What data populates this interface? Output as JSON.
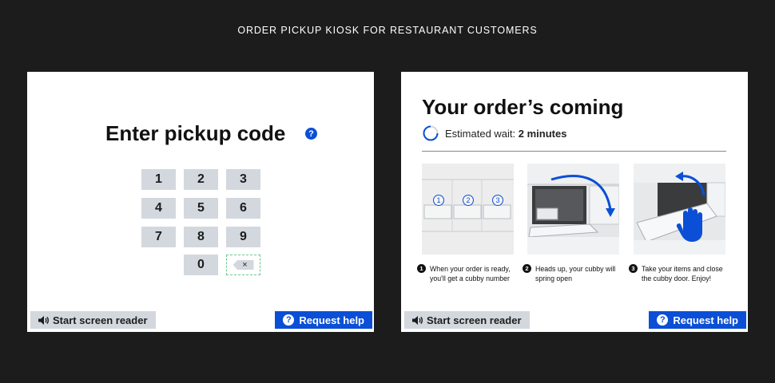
{
  "page": {
    "title": "ORDER PICKUP KIOSK FOR RESTAURANT CUSTOMERS"
  },
  "colors": {
    "accent": "#0b4fd6",
    "key_bg": "#d3d8de",
    "background": "#1c1c1c"
  },
  "left_screen": {
    "title": "Enter pickup code",
    "help_icon": "question-circle-icon",
    "help_symbol": "?",
    "keys": [
      "1",
      "2",
      "3",
      "4",
      "5",
      "6",
      "7",
      "8",
      "9",
      "0"
    ],
    "backspace_symbol": "×",
    "backspace_icon": "backspace-icon"
  },
  "right_screen": {
    "title": "Your order’s coming",
    "wait_label": "Estimated wait:",
    "wait_value": "2 minutes",
    "cubby_labels": [
      "1",
      "2",
      "3"
    ],
    "steps": [
      {
        "num": "1",
        "text": "When your order is ready, you'll get a cubby number"
      },
      {
        "num": "2",
        "text": "Heads up, your cubby will spring open"
      },
      {
        "num": "3",
        "text": "Take your items and close the cubby door. Enjoy!"
      }
    ]
  },
  "footer": {
    "screen_reader_label": "Start screen reader",
    "screen_reader_icon": "speaker-icon",
    "help_label": "Request help",
    "help_symbol": "?",
    "help_icon": "question-circle-icon"
  }
}
